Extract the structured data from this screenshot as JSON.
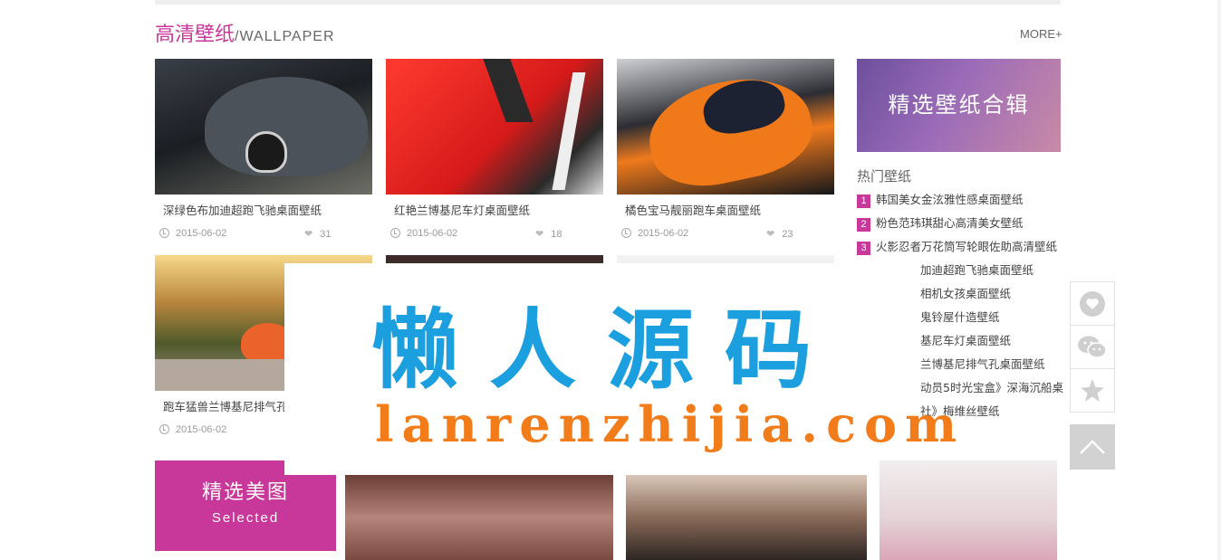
{
  "section": {
    "title_cn": "高清壁纸",
    "title_en": "/WALLPAPER",
    "more": "MORE+"
  },
  "cards": [
    {
      "title": "深绿色布加迪超跑飞驰桌面壁纸",
      "date": "2015-06-02",
      "likes": "31"
    },
    {
      "title": "红艳兰博基尼车灯桌面壁纸",
      "date": "2015-06-02",
      "likes": "18"
    },
    {
      "title": "橘色宝马靓丽跑车桌面壁纸",
      "date": "2015-06-02",
      "likes": "23"
    },
    {
      "title": "跑车猛兽兰博基尼排气孔",
      "date": "2015-06-02",
      "likes": ""
    }
  ],
  "sidebar": {
    "banner": "精选壁纸合辑",
    "hot_title": "热门壁纸",
    "hot_items": [
      {
        "num": "1",
        "label": "韩国美女金泫雅性感桌面壁纸"
      },
      {
        "num": "2",
        "label": "粉色范玮琪甜心高清美女壁纸"
      },
      {
        "num": "3",
        "label": "火影忍者万花筒写轮眼佐助高清壁纸"
      }
    ],
    "plain_items": [
      "加迪超跑飞驰桌面壁纸",
      "相机女孩桌面壁纸",
      "鬼铃屋什造壁纸",
      "基尼车灯桌面壁纸",
      "兰博基尼排气孔桌面壁纸",
      "动员5时光宝盒》深海沉船桌",
      "社》梅维丝壁纸"
    ]
  },
  "watermark": {
    "cn": "懒人源码",
    "en": "lanrenzhijia.com"
  },
  "selected": {
    "title": "精选美图",
    "subtitle": "Selected"
  },
  "colors": {
    "accent": "#c8379a",
    "wm_blue": "#1b9fde",
    "wm_orange": "#f27c1a"
  },
  "icons": {
    "like": "heart-icon",
    "wechat": "wechat-icon",
    "favorite": "star-icon",
    "top": "chevron-up-icon"
  }
}
